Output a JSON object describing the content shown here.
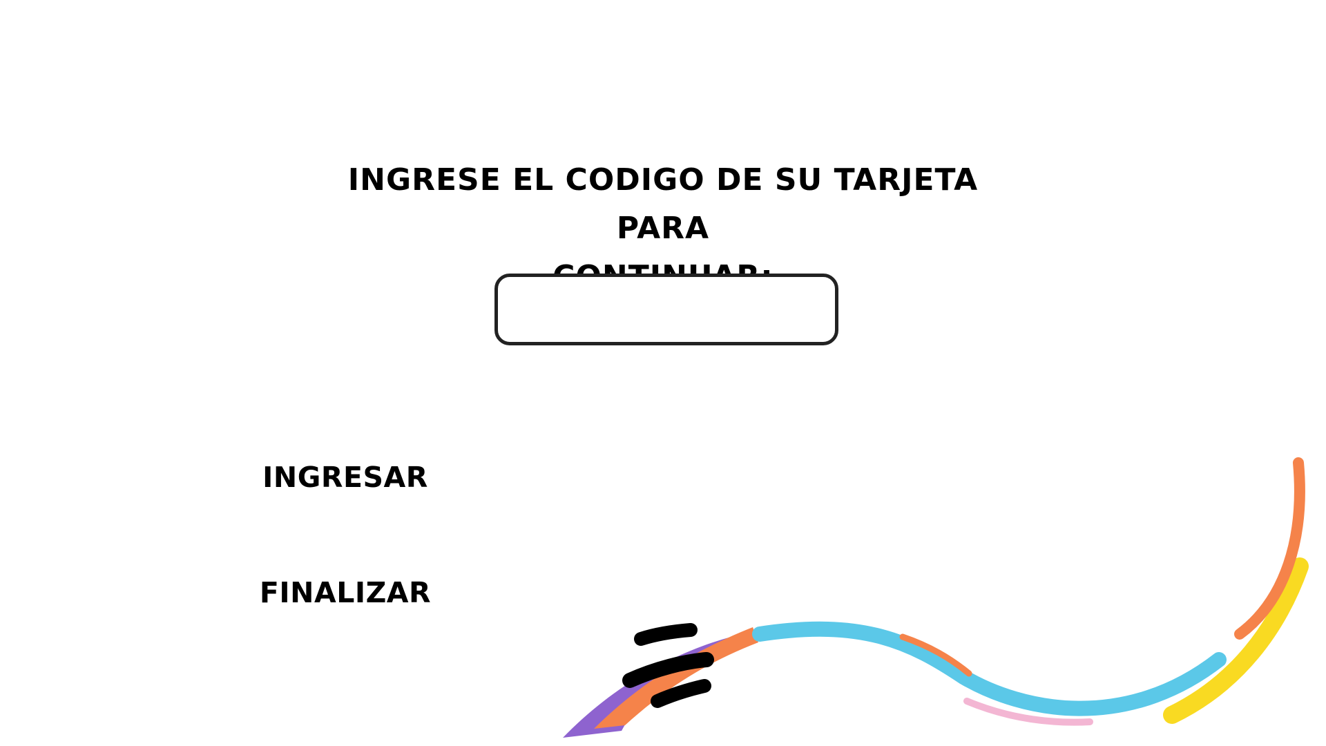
{
  "prompt": {
    "line1": "INGRESE EL CODIGO DE SU TARJETA PARA",
    "line2": "CONTINUAR:"
  },
  "code_input": {
    "value": "",
    "placeholder": ""
  },
  "buttons": {
    "ingresar_label": "INGRESAR",
    "finalizar_label": "FINALIZAR"
  },
  "colors": {
    "text": "#000000",
    "input_border": "#222222",
    "decor_blue": "#5BC8E8",
    "decor_orange": "#F5834A",
    "decor_yellow": "#F9DA22",
    "decor_purple": "#8E63CF",
    "decor_pink": "#F3B6D3",
    "decor_black": "#000000"
  }
}
